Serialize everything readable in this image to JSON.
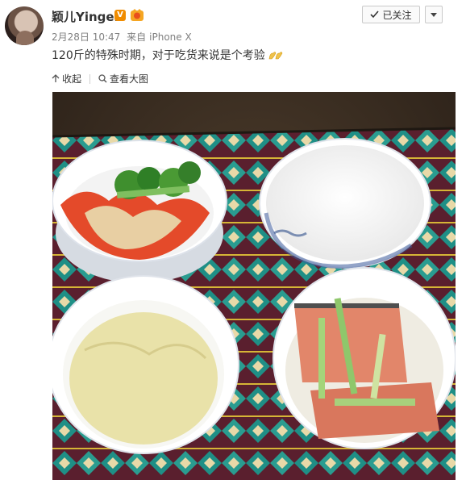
{
  "post": {
    "username": "颖儿Yinger",
    "verified_badge": "V",
    "date": "2月28日 10:47",
    "source_prefix": "来自",
    "source": "iPhone X",
    "text": "120斤的特殊时期，对于吃货来说是个考验"
  },
  "follow": {
    "label": "已关注"
  },
  "actions": {
    "collect": "收起",
    "view_large": "查看大图"
  },
  "colors": {
    "badge": "#f08c00",
    "meta": "#808080"
  },
  "icons": [
    "avatar",
    "verified-icon",
    "member-icon",
    "check-icon",
    "chevron-down-icon",
    "muscle-emoji-icon",
    "collapse-arrow-icon",
    "magnifier-icon"
  ]
}
